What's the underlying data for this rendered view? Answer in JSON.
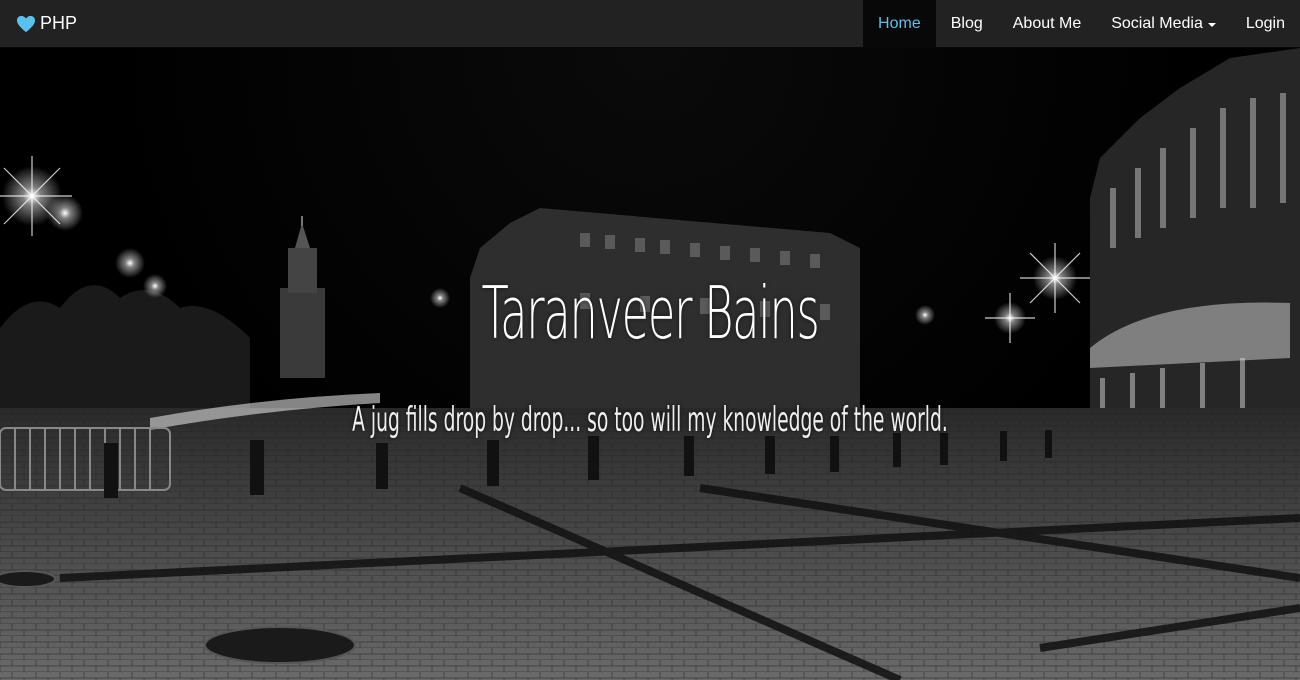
{
  "brand": {
    "label": "PHP",
    "icon": "heart-icon",
    "icon_color": "#5bc0eb"
  },
  "nav": {
    "items": [
      {
        "label": "Home",
        "active": true
      },
      {
        "label": "Blog"
      },
      {
        "label": "About Me"
      },
      {
        "label": "Social Media",
        "dropdown": true
      },
      {
        "label": "Login"
      }
    ],
    "active_color": "#5bc0eb"
  },
  "hero": {
    "title": "Taranveer Bains",
    "subtitle": "A jug fills drop by drop... so too will my knowledge of the world."
  }
}
